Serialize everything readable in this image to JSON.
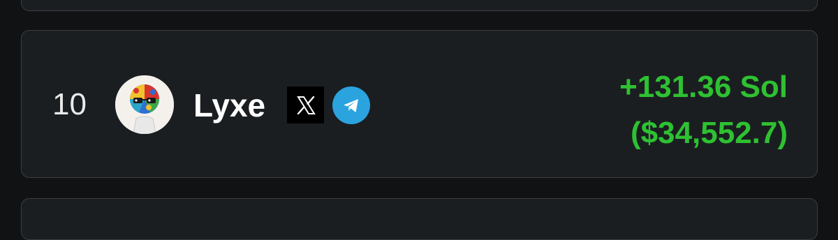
{
  "entry": {
    "rank": "10",
    "name": "Lyxe",
    "pnl_sol": "+131.36 Sol",
    "pnl_usd": "($34,552.7)"
  },
  "icons": {
    "social_x": "x-logo-icon",
    "social_telegram": "telegram-icon"
  },
  "colors": {
    "background": "#111214",
    "card": "#1b1e21",
    "card_border": "#3a3d42",
    "profit": "#2ec132",
    "telegram": "#2aa3df"
  }
}
